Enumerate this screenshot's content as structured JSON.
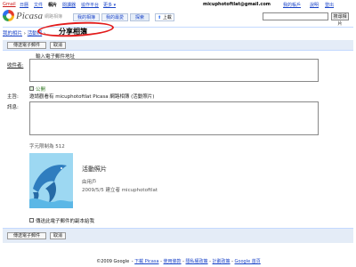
{
  "gbar": {
    "links": [
      "Gmail",
      "日曆",
      "文件",
      "相片",
      "閱讀器",
      "協作平台",
      "更多 ▾"
    ],
    "email": "micuphotoftlat@gmail.com",
    "right_links": [
      "我的帳戶",
      "說明",
      "登出"
    ]
  },
  "header": {
    "logo_text": "Picasa",
    "logo_sub": "網路相簿",
    "tabs": [
      "我的相簿",
      "我的最愛",
      "探索"
    ],
    "upload_label": "上載",
    "search_placeholder": "",
    "search_button": "搜尋相片"
  },
  "breadcrumb": {
    "items": [
      "我的相片",
      "活動照"
    ],
    "separator": "›",
    "current": "分享相簿"
  },
  "actions": {
    "send_label": "傳送電子郵件",
    "cancel_label": "取消"
  },
  "form": {
    "to_label": "收件者:",
    "to_hint": "輸入電子郵件地址",
    "public_label": "公開",
    "subject_label": "主旨:",
    "subject_value": "邀請觀看有 micuphotoftlat Picasa 網路相簿 (活動照片)",
    "message_label": "訊息:",
    "char_count": "字元限制為 512",
    "album_title": "活動照片",
    "album_owner_label": "由用戶",
    "album_date": "2009/5/5 建立者 micuphotoftlat",
    "copy_label": "傳送此電子郵件的副本給我"
  },
  "footer": {
    "items": [
      "©2009 Google",
      "下載 Picasa",
      "使用條款",
      "隱私權政策",
      "計劃政策",
      "Google 首頁"
    ]
  },
  "colors": {
    "accent_blue": "#1a44c8",
    "panel_bg": "#e4ecf7",
    "highlight_red": "#e21b1b"
  }
}
